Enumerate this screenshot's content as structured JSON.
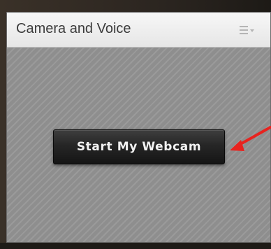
{
  "pod": {
    "title": "Camera and Voice",
    "menu_icon": "pod-menu-icon"
  },
  "main": {
    "start_webcam_label": "Start My Webcam"
  },
  "annotation": {
    "arrow_icon": "red-arrow-icon",
    "arrow_color": "#e8231f"
  },
  "colors": {
    "pod_background": "#8e8e8e",
    "header_background": "#efefef",
    "button_background": "#262626",
    "button_text": "#f2f2f2"
  }
}
